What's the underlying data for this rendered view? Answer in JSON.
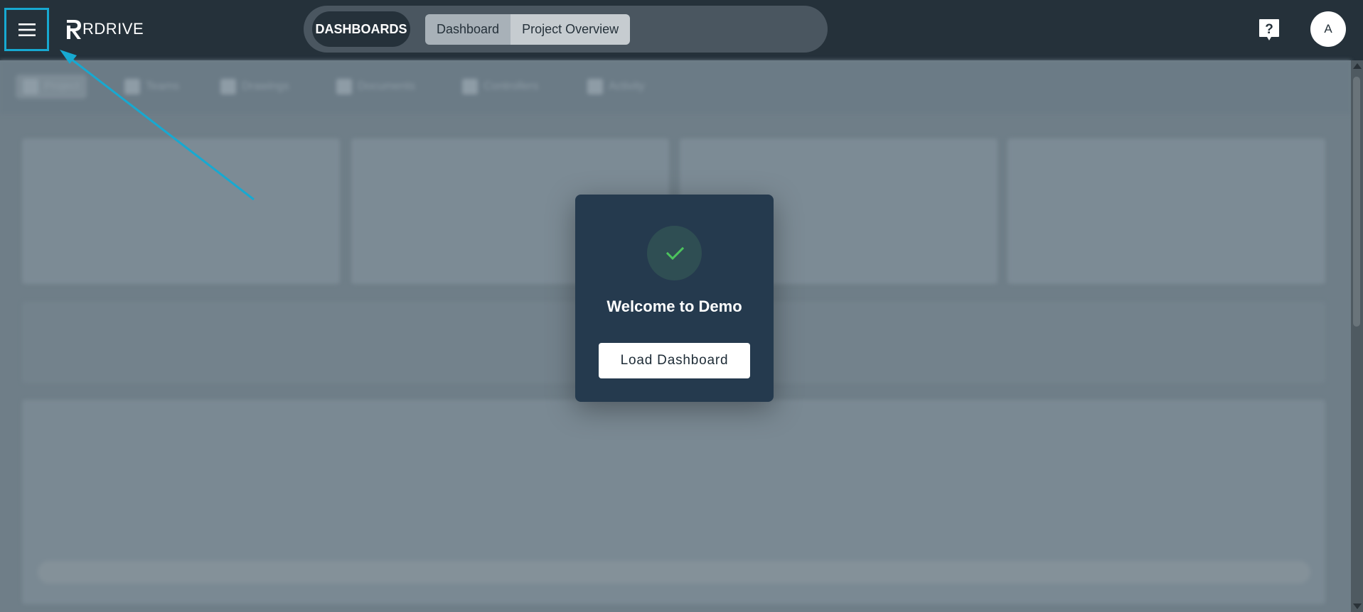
{
  "header": {
    "menu_icon": "hamburger-menu-icon",
    "logo_text": "RDRIVE",
    "dashboards_label": "DASHBOARDS",
    "tabs": [
      {
        "label": "Dashboard"
      },
      {
        "label": "Project Overview"
      }
    ],
    "help_icon": "help-question-icon",
    "avatar_initial": "A"
  },
  "background": {
    "subnav_items": [
      {
        "label": "Project"
      },
      {
        "label": "Teams"
      },
      {
        "label": "Drawings"
      },
      {
        "label": "Documents"
      },
      {
        "label": "Controllers"
      },
      {
        "label": "Activity"
      }
    ]
  },
  "modal": {
    "icon": "check-icon",
    "title": "Welcome to Demo",
    "button_label": "Load Dashboard"
  },
  "colors": {
    "topbar": "#25313a",
    "highlight": "#17a9d1",
    "modal_bg": "#253a4e",
    "success_green": "#4cc35d"
  }
}
